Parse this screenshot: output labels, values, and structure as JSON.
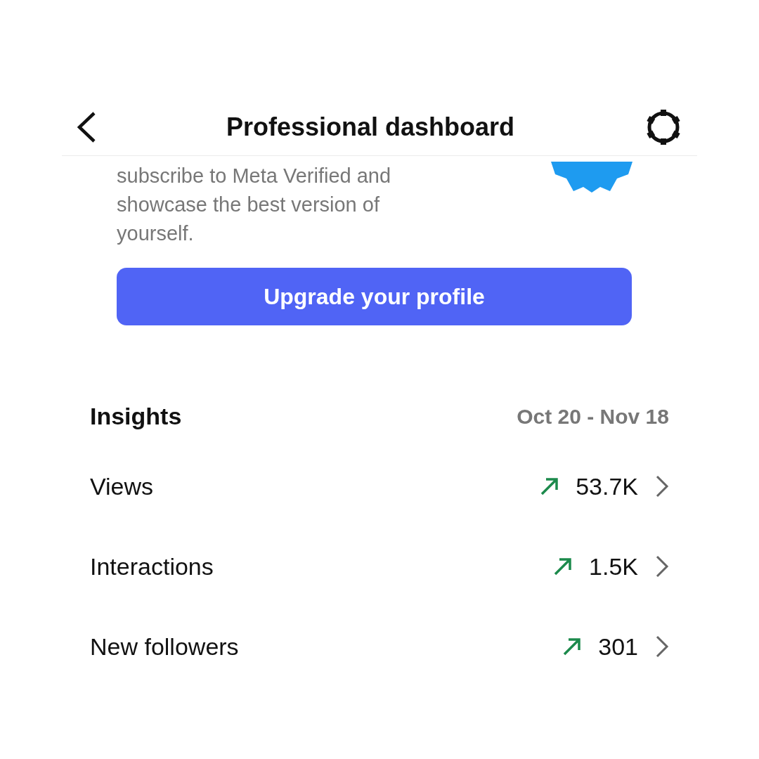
{
  "header": {
    "title": "Professional dashboard"
  },
  "promo": {
    "text": "subscribe to Meta Verified and showcase the best version of yourself.",
    "button": "Upgrade your profile"
  },
  "insights": {
    "title": "Insights",
    "date_range": "Oct 20 - Nov 18",
    "rows": [
      {
        "label": "Views",
        "value": "53.7K",
        "trending_up": true
      },
      {
        "label": "Interactions",
        "value": "1.5K",
        "trending_up": true
      },
      {
        "label": "New followers",
        "value": "301",
        "trending_up": true
      }
    ]
  }
}
